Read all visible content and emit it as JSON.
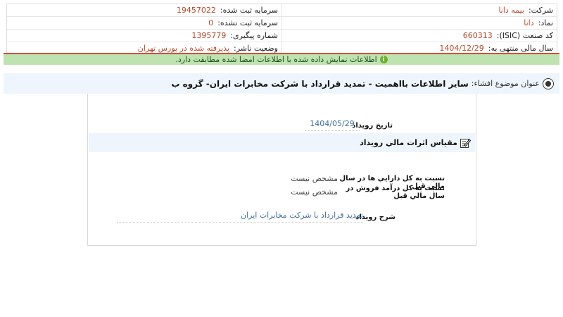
{
  "header": {
    "rows": [
      {
        "right_label": "شرکت:",
        "right_value": "بیمه دانا",
        "left_label": "سرمایه ثبت شده:",
        "left_value": "19457022"
      },
      {
        "right_label": "نماد:",
        "right_value": "دانا",
        "left_label": "سرمایه ثبت نشده:",
        "left_value": "0"
      },
      {
        "right_label": "کد صنعت (ISIC):",
        "right_value": "660313",
        "left_label": "شماره پیگیری:",
        "left_value": "1395779"
      },
      {
        "right_label": "سال مالی منتهی به:",
        "right_value": "1404/12/29",
        "left_label": "وضعیت ناشر:",
        "left_value": "پذیرفته شده در بورس تهران"
      }
    ]
  },
  "notice": {
    "text": "اطلاعات نمایش داده شده با اطلاعات امضا شده مطابقت دارد.",
    "icon": "info-icon"
  },
  "subject": {
    "label": "عنوان موضوع افشاء:",
    "value": "سایر اطلاعات بااهمیت - تمدید قرارداد با شرکت مخابرات ایران- گروه ب",
    "icon": "target-icon"
  },
  "event": {
    "date_label": "تاريخ رويداد",
    "date_value": "1404/05/29"
  },
  "section": {
    "title": "مقياس اثرات مالي رويداد",
    "icon": "edit-icon"
  },
  "metrics": [
    {
      "label": "نسبت به کل دارايي ها در سال مالي قبل",
      "value": "مشخص نیست"
    },
    {
      "label": "نسبت به کل درآمد فروش در سال مالي قبل",
      "value": "مشخص نیست"
    }
  ],
  "description": {
    "label": "شرح رويداد",
    "value": "تمدید قرارداد با شرکت مخابرات ایران"
  }
}
